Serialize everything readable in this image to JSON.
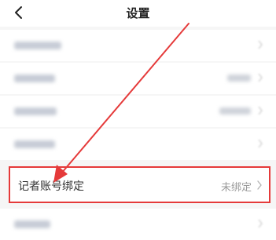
{
  "header": {
    "title": "设置",
    "back_icon": "chevron-left-icon"
  },
  "settings": {
    "highlighted_item": {
      "label": "记者账号绑定",
      "status": "未绑定"
    }
  },
  "annotation": {
    "color": "#e53a3a"
  }
}
